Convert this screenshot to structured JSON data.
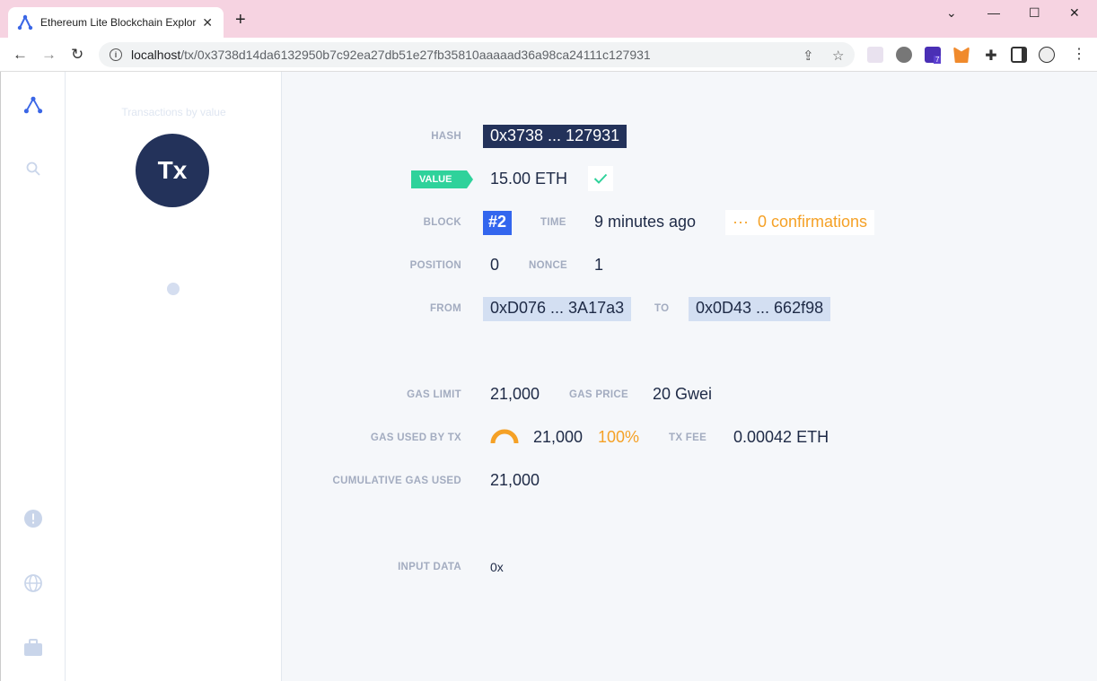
{
  "browser": {
    "tab_title": "Ethereum Lite Blockchain Explor",
    "url_host": "localhost",
    "url_path": "/tx/0x3738d14da6132950b7c92ea27db51e27fb35810aaaaad36a98ca24111c127931",
    "ext_badge": "7"
  },
  "sidebar": {
    "title": "Transactions by value",
    "tx_label": "Tx"
  },
  "tx": {
    "hash_label": "HASH",
    "hash": "0x3738 ... 127931",
    "value_label": "VALUE",
    "value": "15.00 ETH",
    "block_label": "BLOCK",
    "block": "#2",
    "time_label": "TIME",
    "time": "9 minutes ago",
    "confirm_dots": "···",
    "confirmations": "0 confirmations",
    "position_label": "POSITION",
    "position": "0",
    "nonce_label": "NONCE",
    "nonce": "1",
    "from_label": "FROM",
    "from": "0xD076 ... 3A17a3",
    "to_label": "TO",
    "to": "0x0D43 ... 662f98",
    "gas_limit_label": "GAS LIMIT",
    "gas_limit": "21,000",
    "gas_price_label": "GAS PRICE",
    "gas_price": "20 Gwei",
    "gas_used_label": "GAS USED BY TX",
    "gas_used": "21,000",
    "gas_used_pct": "100%",
    "gas_used_fraction": 1.0,
    "tx_fee_label": "TX FEE",
    "tx_fee": "0.00042 ETH",
    "cumulative_label": "CUMULATIVE GAS USED",
    "cumulative": "21,000",
    "input_label": "INPUT DATA",
    "input": "0x"
  },
  "colors": {
    "navy": "#23325a",
    "green": "#2fd29b",
    "blue": "#3366ee",
    "orange": "#f5a126",
    "addr_bg": "#d3dff2"
  }
}
